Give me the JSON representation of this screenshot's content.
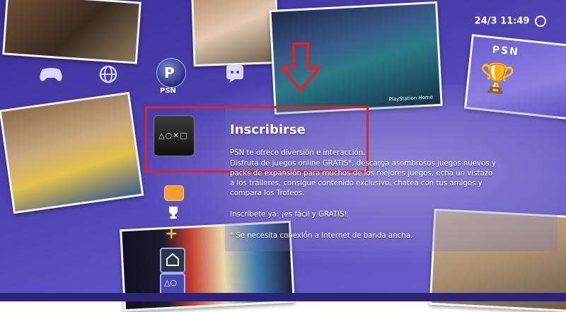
{
  "clock": {
    "text": "24/3 11:49"
  },
  "xmb": {
    "psn_label": "PSN",
    "icons": [
      "controller-icon",
      "globe-icon",
      "psn-icon",
      "chat-icon",
      "friends-icon",
      "trophy-icon",
      "ps-plus-icon",
      "ps-home-icon",
      "ps-store-icon"
    ]
  },
  "detail": {
    "title": "Inscribirse",
    "line1": "PSN te ofrece diversión e interacción.",
    "body": "Disfruta de juegos online GRATIS*, descarga asombrosos juegos nuevos y packs de expansión para muchos de los mejores juegos, echa un vistazo a los tráileres, consigue contenido exclusivo, chatea con tus amigos y compara los Trofeos.",
    "cta": "Inscríbete ya: ¡es fácil y GRATIS!",
    "note": "* Se necesita conexión a Internet de banda ancha."
  },
  "cards": {
    "psn_card_label": "PSN",
    "home_label": "PlayStation Home"
  },
  "colors": {
    "background": "#4b3fae",
    "highlight_box": "#e0232a",
    "arrow": "#e0232a"
  }
}
